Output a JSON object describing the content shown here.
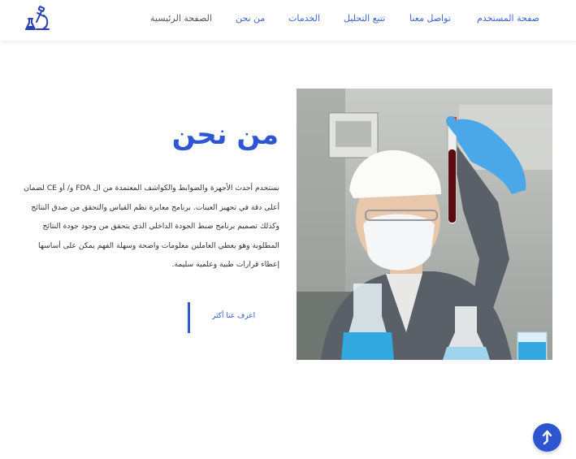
{
  "nav": {
    "user_page": "صفحة المستخدم",
    "contact": "تواصل معنا",
    "track": "تتبع التحليل",
    "services": "الخدمات",
    "about": "من نحن",
    "home": "الصفحة الرئيسية"
  },
  "about": {
    "title": "من نحن",
    "paragraph": "نستخدم أحدث الأجهزة والضوابط والكواشف المعتمدة من ال FDA و/ أو CE لضمان أعلى دقة في تجهيز العينات. برنامج معايرة نظم القياس والتحقق من صدق النتائج وكذلك تصميم برنامج ضبط الجودة الداخلي الذي يتحقق من وجود جودة النتائج المطلوبة وهو يعطي العاملين معلومات واضحة وسهلة الفهم يمكن على أساسها إعطاء قرارات طبية وعلمية سليمة.",
    "more_button": "اعرف عنا أكثر"
  },
  "colors": {
    "accent": "#2e55d3",
    "glove": "#4aa8e8",
    "liquid": "#31a8e0"
  },
  "icons": {
    "logo": "microscope-icon",
    "scroll_top": "arrow-up-icon"
  }
}
